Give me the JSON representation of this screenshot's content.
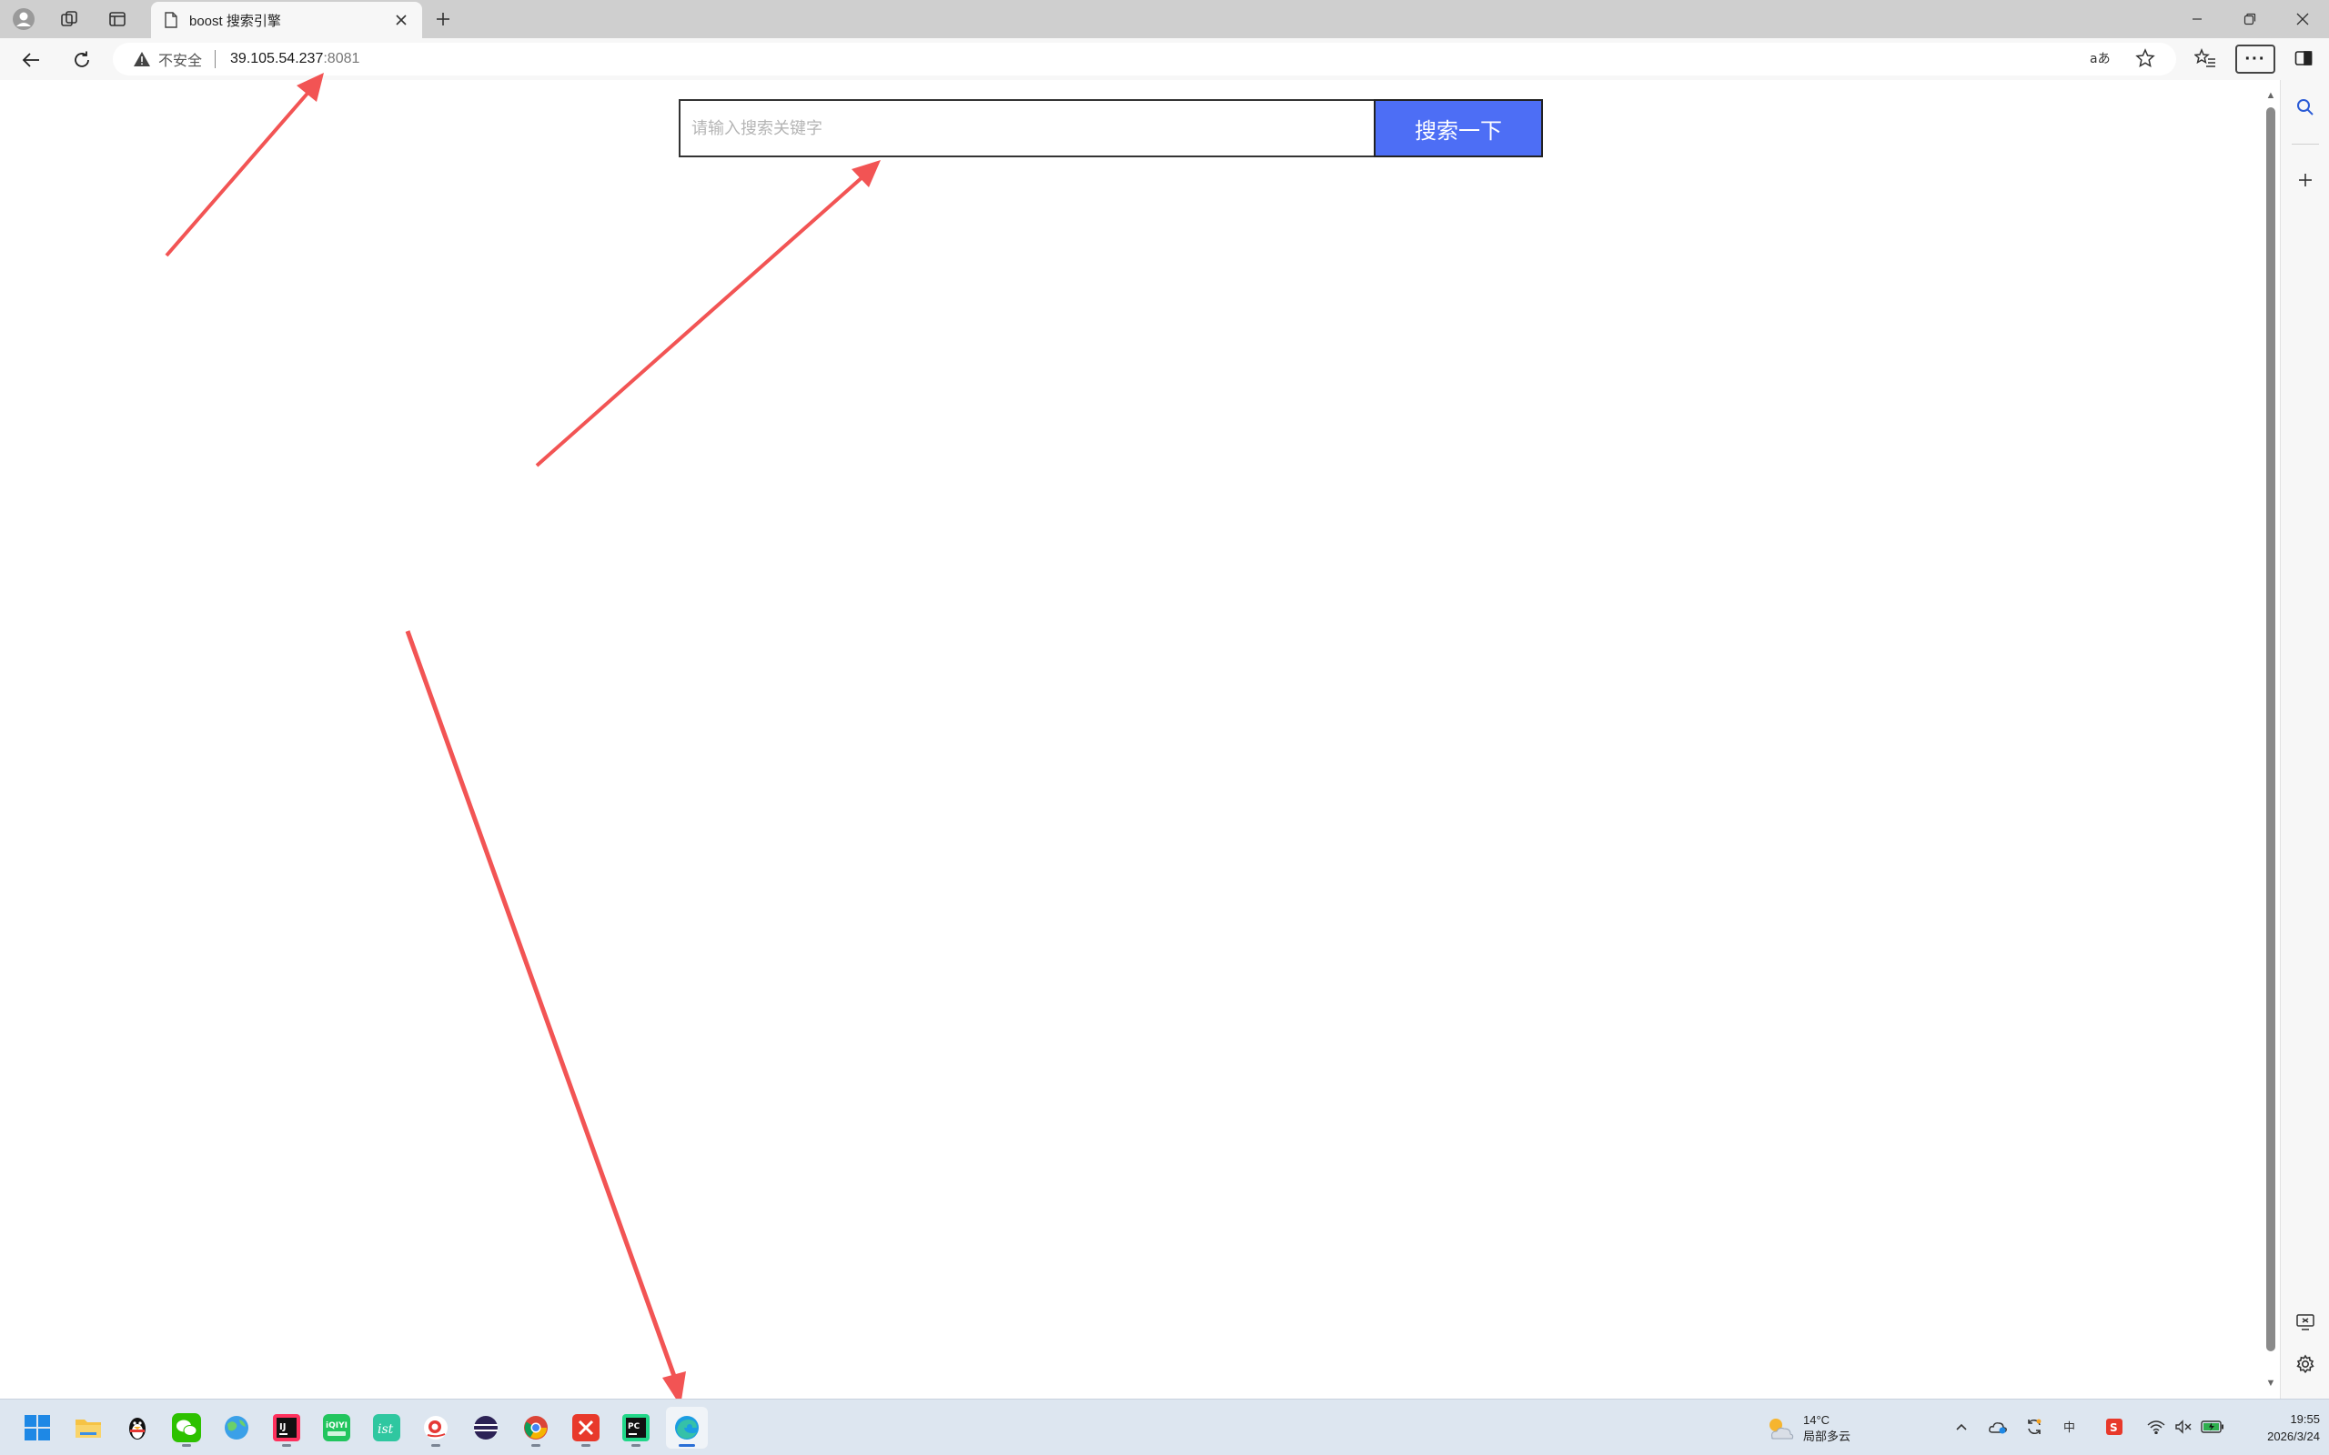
{
  "browser": {
    "tab": {
      "title": "boost 搜索引擎"
    },
    "address": {
      "security_label": "不安全",
      "host": "39.105.54.237",
      "port": ":8081"
    }
  },
  "page": {
    "search": {
      "placeholder": "请输入搜索关键字",
      "button_label": "搜索一下"
    }
  },
  "taskbar": {
    "weather": {
      "temperature": "14°C",
      "condition": "局部多云"
    },
    "clock": {
      "time": "19:55",
      "date": "2026/3/24"
    }
  },
  "colors": {
    "search_button": "#4d6ef5",
    "annotation_arrow": "#f25454",
    "tab_bar": "#cfcfcf",
    "taskbar": "#dde6f0"
  }
}
